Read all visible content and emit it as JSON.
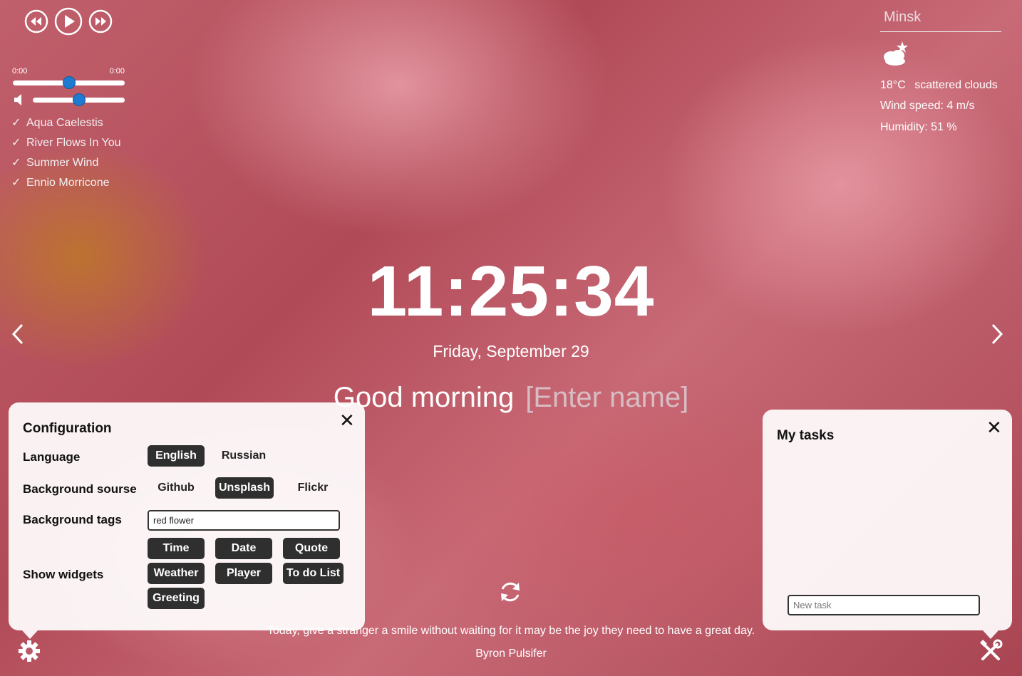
{
  "player": {
    "current_time": "0:00",
    "duration": "0:00",
    "progress": 0.5,
    "volume": 0.5,
    "tracks": [
      {
        "title": "Aqua Caelestis"
      },
      {
        "title": "River Flows In You"
      },
      {
        "title": "Summer Wind"
      },
      {
        "title": "Ennio Morricone"
      }
    ],
    "icons": {
      "prev": "rewind-icon",
      "play": "play-icon",
      "next": "fast-forward-icon",
      "volume": "volume-icon",
      "track_check": "checkmark-icon"
    }
  },
  "weather": {
    "city": "Minsk",
    "icon": "partly-cloudy-icon",
    "temperature": "18°C",
    "description": "scattered clouds",
    "wind": "Wind speed: 4 m/s",
    "humidity": "Humidity: 51 %"
  },
  "clock": {
    "time": "11:25:34",
    "date": "Friday, September 29"
  },
  "greeting": {
    "text": "Good morning",
    "name_placeholder": "[Enter name]"
  },
  "navigation": {
    "prev_icon": "chevron-left-icon",
    "next_icon": "chevron-right-icon"
  },
  "config": {
    "title": "Configuration",
    "language_label": "Language",
    "languages": [
      {
        "label": "English",
        "active": true
      },
      {
        "label": "Russian",
        "active": false
      }
    ],
    "source_label": "Background sourse",
    "sources": [
      {
        "label": "Github",
        "active": false
      },
      {
        "label": "Unsplash",
        "active": true
      },
      {
        "label": "Flickr",
        "active": false
      }
    ],
    "tags_label": "Background tags",
    "tags_value": "red flower",
    "widgets_label": "Show widgets",
    "widgets": [
      {
        "label": "Time",
        "active": true
      },
      {
        "label": "Date",
        "active": true
      },
      {
        "label": "Quote",
        "active": true
      },
      {
        "label": "Weather",
        "active": true
      },
      {
        "label": "Player",
        "active": true
      },
      {
        "label": "To do List",
        "active": true
      },
      {
        "label": "Greeting",
        "active": true
      }
    ]
  },
  "tasks": {
    "title": "My tasks",
    "input_placeholder": "New task"
  },
  "quote": {
    "text": "Today, give a stranger a smile without waiting for it may be the joy they need to have a great day.",
    "author": "Byron Pulsifer",
    "refresh_icon": "refresh-icon"
  },
  "footer": {
    "settings_icon": "gear-icon",
    "tools_icon": "tools-icon"
  },
  "colors": {
    "accent": "#1e7bd0",
    "button_dark": "#2f2f2f"
  }
}
